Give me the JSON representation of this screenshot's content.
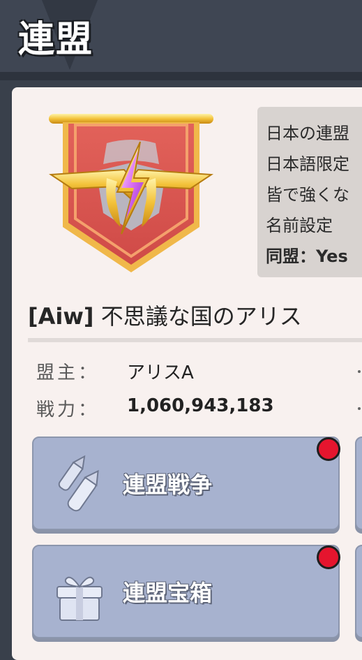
{
  "header": {
    "title": "連盟"
  },
  "description": {
    "lines": [
      "日本の連盟",
      "日本語限定",
      "皆で強くな",
      "名前設定",
      "同盟：Yes"
    ]
  },
  "alliance": {
    "tag": "[Aiw]",
    "name": "不思議な国のアリス"
  },
  "info": {
    "leader_label": "盟主：",
    "leader_value": "アリスA",
    "power_label": "戦力：",
    "power_value": "1,060,943,183"
  },
  "buttons": [
    {
      "label": "連盟戦争",
      "icon": "missile-icon",
      "has_badge": true
    },
    {
      "label": "連盟宝箱",
      "icon": "gift-box-icon",
      "has_badge": true
    }
  ],
  "colors": {
    "header_bg": "#3f4653",
    "panel_bg": "#f8f1ef",
    "button_bg": "#a7b2cf",
    "badge": "#e5152e"
  }
}
